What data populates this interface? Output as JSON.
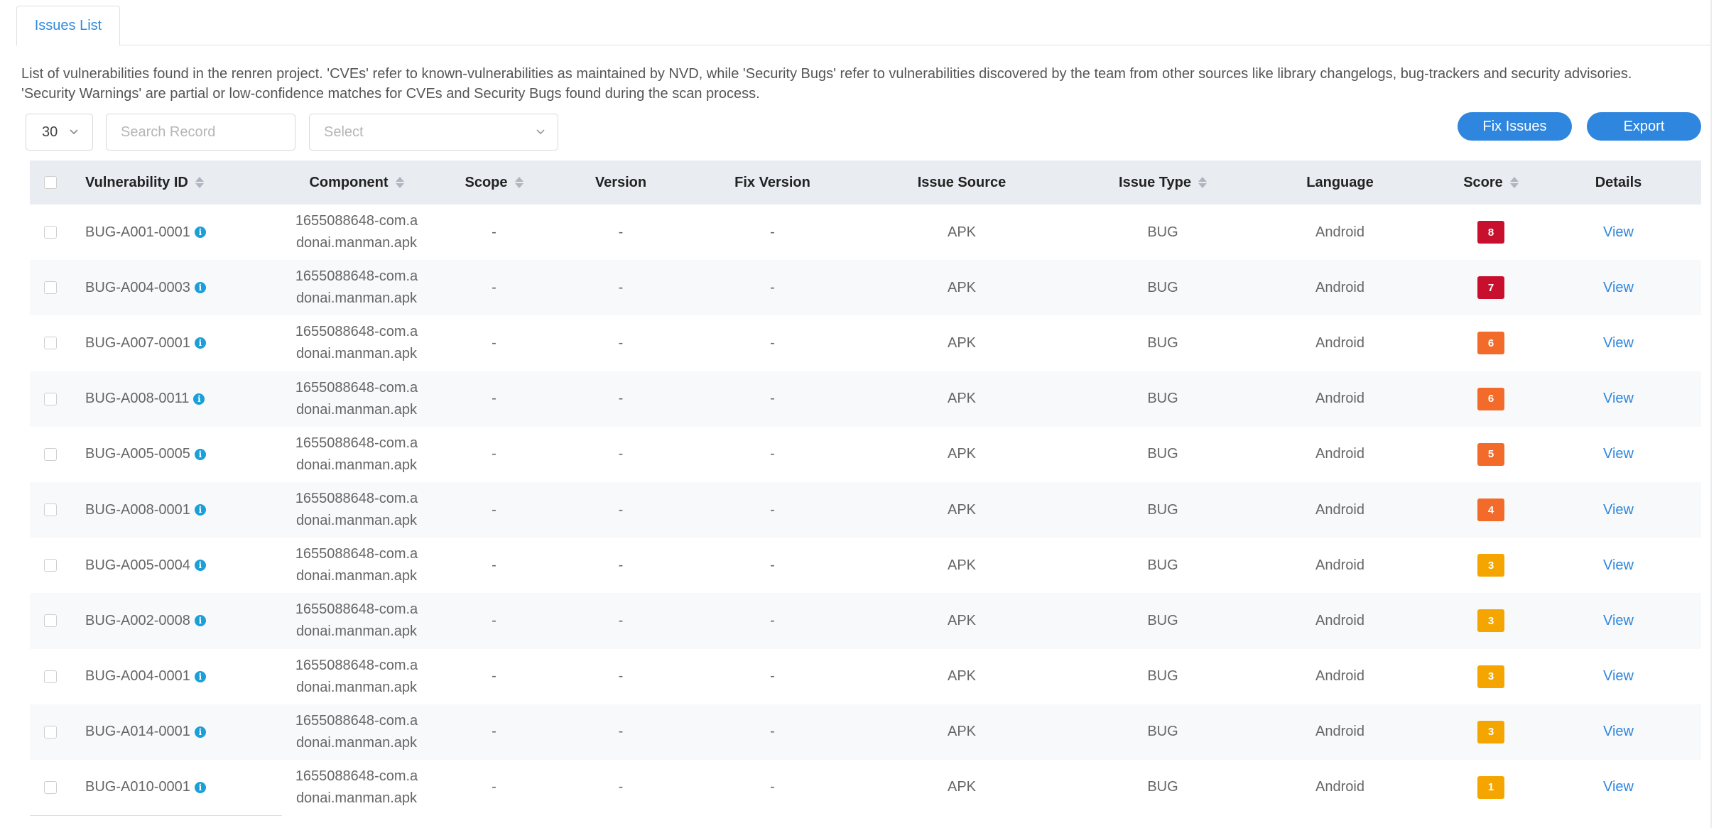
{
  "tab": {
    "label": "Issues List"
  },
  "description": "List of vulnerabilities found in the renren project. 'CVEs' refer to known-vulnerabilities as maintained by NVD, while 'Security Bugs' refer to vulnerabilities discovered by the team from other sources like library changelogs, bug-trackers and security advisories. 'Security Warnings' are partial or low-confidence matches for CVEs and Security Bugs found during the scan process.",
  "toolbar": {
    "page_size": "30",
    "search_placeholder": "Search Record",
    "select_placeholder": "Select",
    "fix_label": "Fix Issues",
    "export_label": "Export"
  },
  "columns": {
    "id": "Vulnerability ID",
    "component": "Component",
    "scope": "Scope",
    "version": "Version",
    "fix_version": "Fix Version",
    "source": "Issue Source",
    "type": "Issue Type",
    "language": "Language",
    "score": "Score",
    "details": "Details"
  },
  "rows": [
    {
      "id": "BUG-A001-0001",
      "component": "1655088648-com.adonai.manman.apk",
      "scope": "-",
      "version": "-",
      "fix_version": "-",
      "source": "APK",
      "type": "BUG",
      "language": "Android",
      "score": "8",
      "score_color": "#c8102e",
      "details": "View"
    },
    {
      "id": "BUG-A004-0003",
      "component": "1655088648-com.adonai.manman.apk",
      "scope": "-",
      "version": "-",
      "fix_version": "-",
      "source": "APK",
      "type": "BUG",
      "language": "Android",
      "score": "7",
      "score_color": "#c8102e",
      "details": "View"
    },
    {
      "id": "BUG-A007-0001",
      "component": "1655088648-com.adonai.manman.apk",
      "scope": "-",
      "version": "-",
      "fix_version": "-",
      "source": "APK",
      "type": "BUG",
      "language": "Android",
      "score": "6",
      "score_color": "#f26b2a",
      "details": "View"
    },
    {
      "id": "BUG-A008-0011",
      "component": "1655088648-com.adonai.manman.apk",
      "scope": "-",
      "version": "-",
      "fix_version": "-",
      "source": "APK",
      "type": "BUG",
      "language": "Android",
      "score": "6",
      "score_color": "#f26b2a",
      "details": "View"
    },
    {
      "id": "BUG-A005-0005",
      "component": "1655088648-com.adonai.manman.apk",
      "scope": "-",
      "version": "-",
      "fix_version": "-",
      "source": "APK",
      "type": "BUG",
      "language": "Android",
      "score": "5",
      "score_color": "#f26b2a",
      "details": "View"
    },
    {
      "id": "BUG-A008-0001",
      "component": "1655088648-com.adonai.manman.apk",
      "scope": "-",
      "version": "-",
      "fix_version": "-",
      "source": "APK",
      "type": "BUG",
      "language": "Android",
      "score": "4",
      "score_color": "#f26b2a",
      "details": "View"
    },
    {
      "id": "BUG-A005-0004",
      "component": "1655088648-com.adonai.manman.apk",
      "scope": "-",
      "version": "-",
      "fix_version": "-",
      "source": "APK",
      "type": "BUG",
      "language": "Android",
      "score": "3",
      "score_color": "#f5a500",
      "details": "View"
    },
    {
      "id": "BUG-A002-0008",
      "component": "1655088648-com.adonai.manman.apk",
      "scope": "-",
      "version": "-",
      "fix_version": "-",
      "source": "APK",
      "type": "BUG",
      "language": "Android",
      "score": "3",
      "score_color": "#f5a500",
      "details": "View"
    },
    {
      "id": "BUG-A004-0001",
      "component": "1655088648-com.adonai.manman.apk",
      "scope": "-",
      "version": "-",
      "fix_version": "-",
      "source": "APK",
      "type": "BUG",
      "language": "Android",
      "score": "3",
      "score_color": "#f5a500",
      "details": "View"
    },
    {
      "id": "BUG-A014-0001",
      "component": "1655088648-com.adonai.manman.apk",
      "scope": "-",
      "version": "-",
      "fix_version": "-",
      "source": "APK",
      "type": "BUG",
      "language": "Android",
      "score": "3",
      "score_color": "#f5a500",
      "details": "View"
    },
    {
      "id": "BUG-A010-0001",
      "component": "1655088648-com.adonai.manman.apk",
      "scope": "-",
      "version": "-",
      "fix_version": "-",
      "source": "APK",
      "type": "BUG",
      "language": "Android",
      "score": "1",
      "score_color": "#f5a500",
      "details": "View"
    }
  ]
}
